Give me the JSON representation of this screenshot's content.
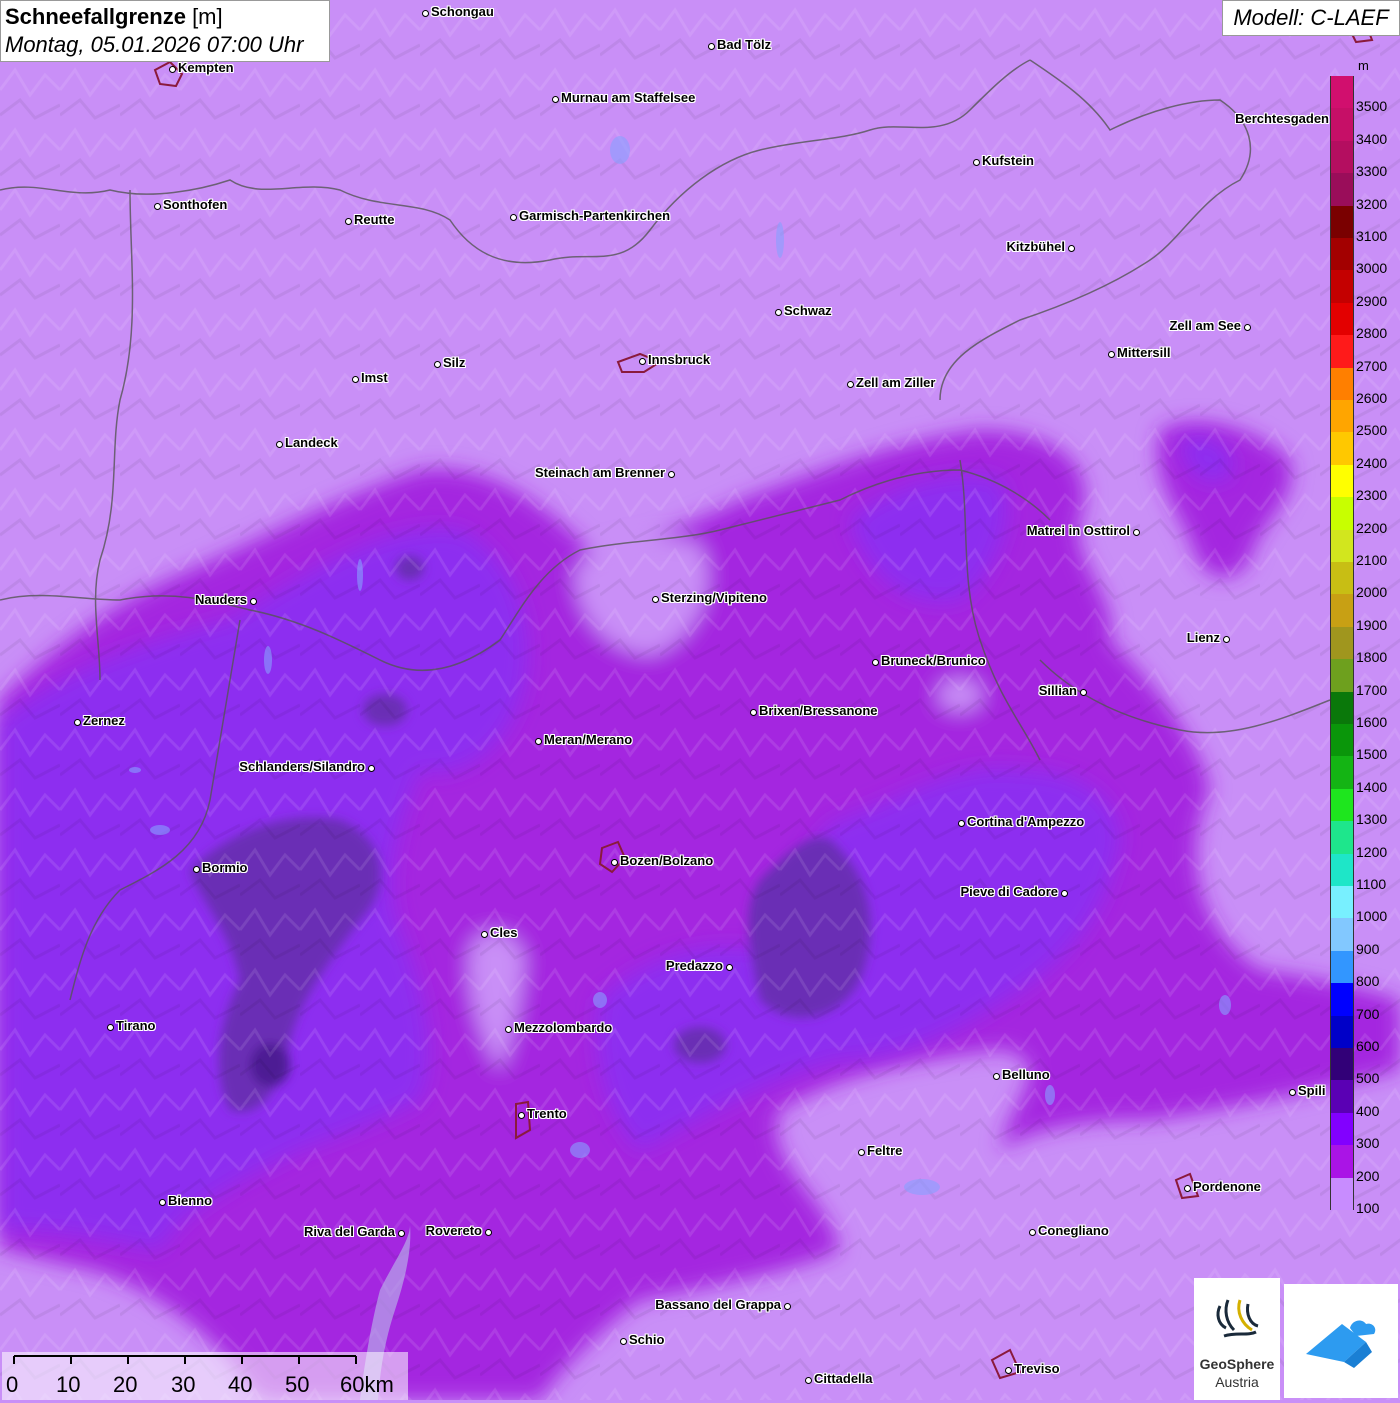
{
  "header": {
    "title_bold": "Schneefallgrenze",
    "title_unit": " [m]",
    "datetime": "Montag, 05.01.2026 07:00 Uhr",
    "model": "Modell: C-LAEF"
  },
  "legend": {
    "unit": "m",
    "levels": [
      {
        "label": "3500",
        "color": "#d10f6e"
      },
      {
        "label": "3400",
        "color": "#c60f67"
      },
      {
        "label": "3300",
        "color": "#b40e60"
      },
      {
        "label": "3200",
        "color": "#9a0d5a"
      },
      {
        "label": "3100",
        "color": "#7a0000"
      },
      {
        "label": "3000",
        "color": "#a30000"
      },
      {
        "label": "2900",
        "color": "#c40000"
      },
      {
        "label": "2800",
        "color": "#e30000"
      },
      {
        "label": "2700",
        "color": "#ff1a1a"
      },
      {
        "label": "2600",
        "color": "#ff7f00"
      },
      {
        "label": "2500",
        "color": "#ffa500"
      },
      {
        "label": "2400",
        "color": "#ffc800"
      },
      {
        "label": "2300",
        "color": "#ffff00"
      },
      {
        "label": "2200",
        "color": "#c8ff00"
      },
      {
        "label": "2100",
        "color": "#d2e61e"
      },
      {
        "label": "2000",
        "color": "#c8be14"
      },
      {
        "label": "1900",
        "color": "#c8a014"
      },
      {
        "label": "1800",
        "color": "#a0961e"
      },
      {
        "label": "1700",
        "color": "#6ea01e"
      },
      {
        "label": "1600",
        "color": "#0a780a"
      },
      {
        "label": "1500",
        "color": "#0a960a"
      },
      {
        "label": "1400",
        "color": "#14b414"
      },
      {
        "label": "1300",
        "color": "#1ee61e"
      },
      {
        "label": "1200",
        "color": "#1ee68c"
      },
      {
        "label": "1100",
        "color": "#1ee6c8"
      },
      {
        "label": "1000",
        "color": "#78f0ff"
      },
      {
        "label": "900",
        "color": "#82c8ff"
      },
      {
        "label": "800",
        "color": "#3296ff"
      },
      {
        "label": "700",
        "color": "#0000ff"
      },
      {
        "label": "600",
        "color": "#0000c8"
      },
      {
        "label": "500",
        "color": "#320078"
      },
      {
        "label": "400",
        "color": "#5a00b4"
      },
      {
        "label": "300",
        "color": "#8200ff"
      },
      {
        "label": "200",
        "color": "#aa14e6"
      },
      {
        "label": "100",
        "color": "#c88cff"
      }
    ]
  },
  "cities": [
    {
      "name": "Schongau",
      "side": "r"
    },
    {
      "name": "Bad Tölz",
      "side": "r"
    },
    {
      "name": "Kempten",
      "side": "r"
    },
    {
      "name": "Murnau am Staffelsee",
      "side": "r"
    },
    {
      "name": "Berchtesgaden",
      "side": "l"
    },
    {
      "name": "Kufstein",
      "side": "r"
    },
    {
      "name": "Sonthofen",
      "side": "r"
    },
    {
      "name": "Reutte",
      "side": "r"
    },
    {
      "name": "Garmisch-Partenkirchen",
      "side": "r"
    },
    {
      "name": "Kitzbühel",
      "side": "l"
    },
    {
      "name": "Schwaz",
      "side": "r"
    },
    {
      "name": "Zell am See",
      "side": "l"
    },
    {
      "name": "Innsbruck",
      "side": "r"
    },
    {
      "name": "Imst",
      "side": "r"
    },
    {
      "name": "Silz",
      "side": "r"
    },
    {
      "name": "Mittersill",
      "side": "r"
    },
    {
      "name": "Zell am Ziller",
      "side": "r"
    },
    {
      "name": "Landeck",
      "side": "r"
    },
    {
      "name": "Steinach am Brenner",
      "side": "l"
    },
    {
      "name": "Matrei in Osttirol",
      "side": "l"
    },
    {
      "name": "Nauders",
      "side": "l"
    },
    {
      "name": "Sterzing/Vipiteno",
      "side": "r"
    },
    {
      "name": "Lienz",
      "side": "l"
    },
    {
      "name": "Bruneck/Brunico",
      "side": "r"
    },
    {
      "name": "Sillian",
      "side": "l"
    },
    {
      "name": "Zernez",
      "side": "r"
    },
    {
      "name": "Brixen/Bressanone",
      "side": "r"
    },
    {
      "name": "Meran/Merano",
      "side": "r"
    },
    {
      "name": "Schlanders/Silandro",
      "side": "l"
    },
    {
      "name": "Cortina d'Ampezzo",
      "side": "r"
    },
    {
      "name": "Bozen/Bolzano",
      "side": "r"
    },
    {
      "name": "Bormio",
      "side": "r"
    },
    {
      "name": "Pieve di Cadore",
      "side": "l"
    },
    {
      "name": "Cles",
      "side": "r"
    },
    {
      "name": "Predazzo",
      "side": "l"
    },
    {
      "name": "Tirano",
      "side": "r"
    },
    {
      "name": "Mezzolombardo",
      "side": "r"
    },
    {
      "name": "Belluno",
      "side": "r"
    },
    {
      "name": "Spili",
      "side": "r"
    },
    {
      "name": "Trento",
      "side": "r"
    },
    {
      "name": "Feltre",
      "side": "r"
    },
    {
      "name": "Pordenone",
      "side": "r"
    },
    {
      "name": "Bienno",
      "side": "r"
    },
    {
      "name": "Riva del Garda",
      "side": "l"
    },
    {
      "name": "Rovereto",
      "side": "l"
    },
    {
      "name": "Conegliano",
      "side": "r"
    },
    {
      "name": "Bassano del Grappa",
      "side": "l"
    },
    {
      "name": "Schio",
      "side": "r"
    },
    {
      "name": "Treviso",
      "side": "r"
    },
    {
      "name": "Cittadella",
      "side": "r"
    }
  ],
  "scalebar": {
    "labels": [
      "0",
      "10",
      "20",
      "30",
      "40",
      "50",
      "60km"
    ]
  },
  "logo": {
    "name": "GeoSphere",
    "sub": "Austria"
  },
  "icons": {
    "app": "cloud-logo-icon",
    "geosphere": "geosphere-logo-icon"
  }
}
